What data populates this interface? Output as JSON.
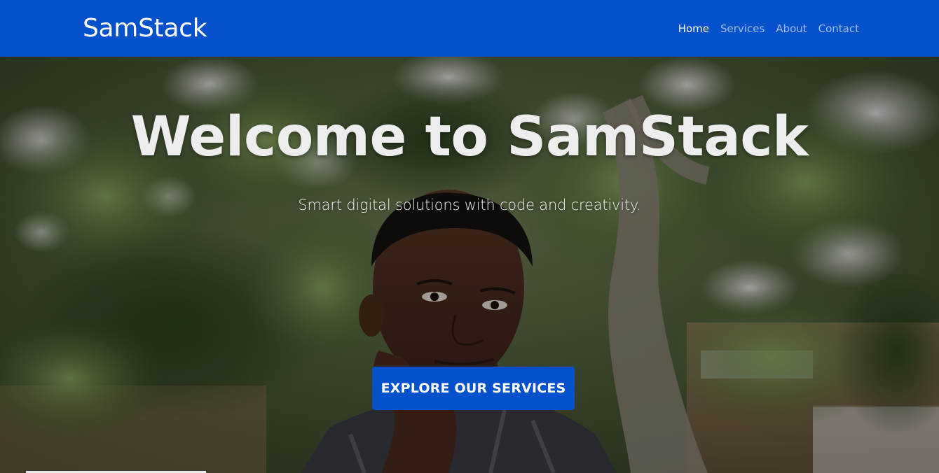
{
  "navbar": {
    "brand": "SamStack",
    "links": [
      {
        "label": "Home",
        "active": true
      },
      {
        "label": "Services",
        "active": false
      },
      {
        "label": "About",
        "active": false
      },
      {
        "label": "Contact",
        "active": false
      }
    ]
  },
  "hero": {
    "title": "Welcome to SamStack",
    "subtitle": "Smart digital solutions with code and creativity.",
    "cta_label": "EXPLORE OUR SERVICES",
    "background_image": "portrait-of-young-man-under-tree"
  },
  "colors": {
    "brand_blue": "#0451cb",
    "hero_text": "#ededed"
  }
}
